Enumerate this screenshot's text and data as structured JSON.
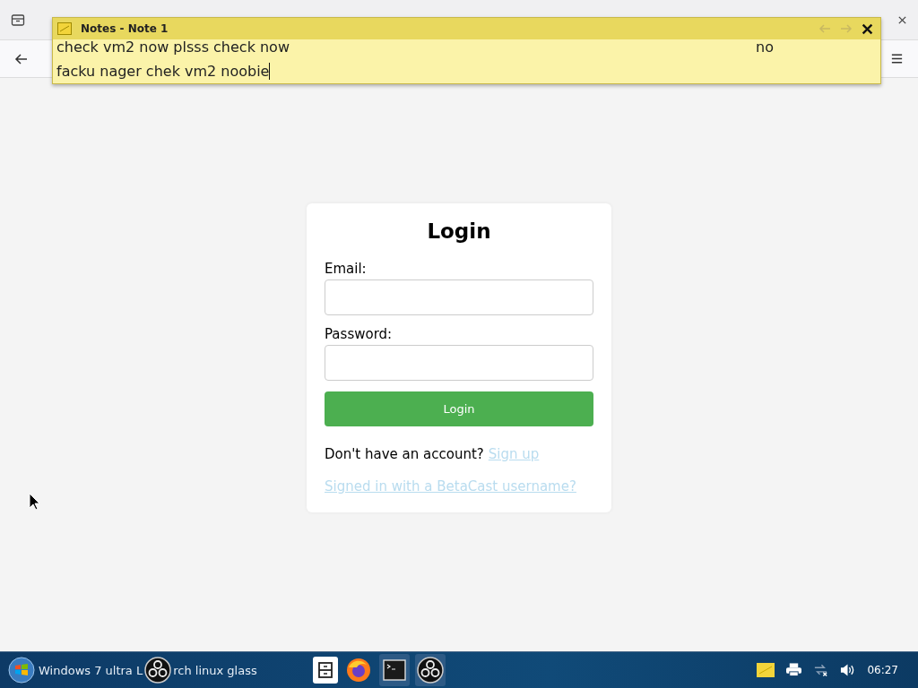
{
  "note": {
    "title": "Notes - Note 1",
    "lines": [
      {
        "text": "check vm2 now plsss check now",
        "aside": "no"
      },
      {
        "text": "facku nager chek vm2 noobie"
      }
    ]
  },
  "login": {
    "title": "Login",
    "fields": [
      {
        "label": "Email:"
      },
      {
        "label": "Password:"
      }
    ],
    "button": "Login",
    "signup_prompt": "Don't have an account?",
    "signup_link": "Sign up",
    "alt_link": "Signed in with a BetaCast username?"
  },
  "taskbar": {
    "title_start": "Windows 7 ultra L",
    "title_end": "rch linux glass",
    "clock": "06:27"
  }
}
